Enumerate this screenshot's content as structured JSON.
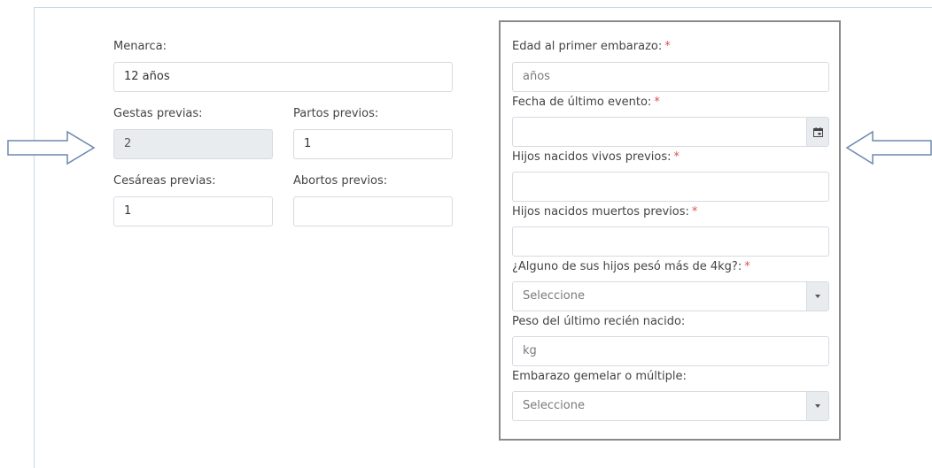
{
  "left": {
    "menarca": {
      "label": "Menarca:",
      "value": "12 años"
    },
    "gestas": {
      "label": "Gestas previas:",
      "value": "2"
    },
    "partos": {
      "label": "Partos previos:",
      "value": "1"
    },
    "cesareas": {
      "label": "Cesáreas previas:",
      "value": "1"
    },
    "abortos": {
      "label": "Abortos previos:",
      "value": ""
    }
  },
  "right": {
    "edad": {
      "label": "Edad al primer embarazo:",
      "placeholder": "años"
    },
    "fecha": {
      "label": "Fecha de último evento:",
      "value": ""
    },
    "vivos": {
      "label": "Hijos nacidos vivos previos:",
      "value": ""
    },
    "muertos": {
      "label": "Hijos nacidos muertos previos:",
      "value": ""
    },
    "peso4kg": {
      "label": "¿Alguno de sus hijos pesó más de 4kg?:",
      "selected": "Seleccione"
    },
    "peso": {
      "label": "Peso del último recién nacido:",
      "placeholder": "kg"
    },
    "gemelar": {
      "label": "Embarazo gemelar o múltiple:",
      "selected": "Seleccione"
    }
  },
  "required_marker": "*",
  "icons": {
    "calendar": "calendar-icon",
    "dropdown": "caret-down-icon",
    "arrows": "arrow-outline-icon"
  }
}
